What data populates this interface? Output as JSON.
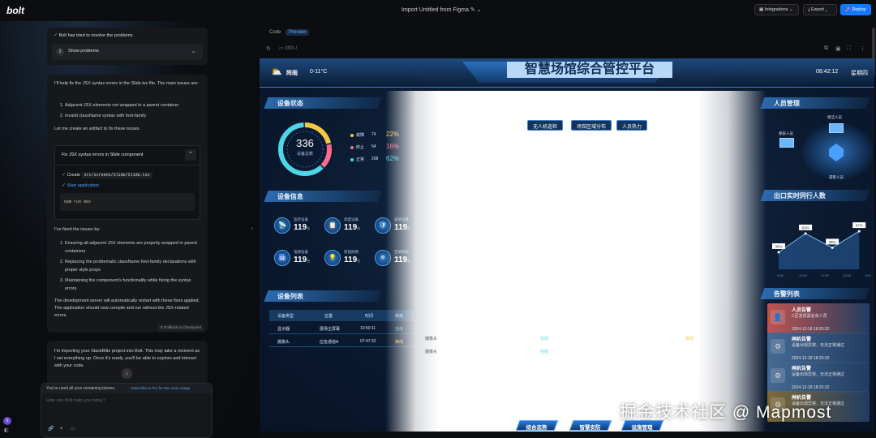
{
  "topbar": {
    "logo": "bolt",
    "project_title": "Import Untitled from Figma",
    "integrations": "Integrations",
    "export": "Export",
    "deploy": "Deploy"
  },
  "chat": {
    "resolved_text": "Bolt has tried to resolve the problems.",
    "show_problems_num": "3",
    "show_problems_label": "Show problems",
    "msg_intro": "I'll help fix the JSX syntax errors in the Slide.tsx file. The main issues are:",
    "issues": [
      "Adjacent JSX elements not wrapped in a parent container",
      "Invalid className syntax with font-family"
    ],
    "msg_artifact": "Let me create an artifact to fix these issues.",
    "artifact_title": "Fix JSX syntax errors in Slide component",
    "artifact_create": "Create",
    "artifact_file": "src/screens/Slide/Slide.tsx",
    "artifact_start": "Start application",
    "artifact_cmd": "npm run dev",
    "fixed_intro": "I've fixed the issues by:",
    "fixes": [
      "Ensuring all adjacent JSX elements are properly wrapped in parent containers",
      "Replacing the problematic className font-family declarations with proper style props",
      "Maintaining the component's functionality while fixing the syntax errors"
    ],
    "fixed_outro": "The development server will automatically restart with these fixes applied. The application should now compile and run without the JSX-related errors.",
    "rollback": "Rollback to Checkpoint",
    "import_msg": "I'm importing your StackBlitz project into Bolt. This may take a moment as I set everything up. Once it's ready, you'll be able to explore and interact with your code.",
    "tokens_msg": "You've used all your remaining tokens.",
    "subscribe_link": "Subscribe to Pro for 66x more usage",
    "input_placeholder": "How can Bolt help you today?",
    "avatar_initial": "b"
  },
  "preview": {
    "tab_code": "Code",
    "tab_preview": "Preview",
    "address": "/",
    "screen": {
      "weather": "阵雨",
      "temp": "0-11°C",
      "title": "智慧场馆综合管控平台",
      "time": "08:42:12",
      "weekday": "星期四",
      "sec_device_status": "设备状态",
      "sec_device_info": "设备信息",
      "sec_device_list": "设备列表",
      "sec_people": "人员管理",
      "sec_traffic": "出口实时同行人数",
      "sec_alarms": "告警列表",
      "pills": [
        "无人机巡检",
        "场馆区域分布",
        "人员热力"
      ],
      "donut": {
        "total": "336",
        "total_label": "设备总数",
        "fault": 0.22,
        "offline": 0.16,
        "normal": 0.62
      },
      "status_rows": [
        {
          "label": "故障",
          "count": "74",
          "pct": "22%",
          "color": "#f5c842"
        },
        {
          "label": "终止",
          "count": "54",
          "pct": "16%",
          "color": "#ff6b8a"
        },
        {
          "label": "正常",
          "count": "208",
          "pct": "62%",
          "color": "#4dd6e8"
        }
      ],
      "devices": [
        {
          "label": "监控设备",
          "value": "119",
          "unit": "台",
          "icon": "📡"
        },
        {
          "label": "调度设备",
          "value": "119",
          "unit": "台",
          "icon": "📋"
        },
        {
          "label": "安防设备",
          "value": "119",
          "unit": "台",
          "icon": "🛡"
        },
        {
          "label": "电梯设备",
          "value": "119",
          "unit": "台",
          "icon": "🛗"
        },
        {
          "label": "智能照明",
          "value": "119",
          "unit": "台",
          "icon": "💡"
        },
        {
          "label": "空调系统",
          "value": "119",
          "unit": "台",
          "icon": "❄"
        }
      ],
      "list_headers": [
        "设备类型",
        "位置",
        "时间",
        "状态"
      ],
      "list_rows": [
        {
          "type": "显示器",
          "loc": "展场主屏幕",
          "time": "10:50:11",
          "status": "在线",
          "status_color": "#4dd6e8"
        },
        {
          "type": "摄像头",
          "loc": "应急通道A",
          "time": "07:47:32",
          "status": "离线",
          "status_color": "#f5c842"
        }
      ],
      "ghost_texts": [
        "在线",
        "离线",
        "在线",
        "摄像头",
        "摄像头"
      ],
      "people_labels": [
        "保洁人员",
        "保安人员",
        "游客人员"
      ],
      "traffic": {
        "points": [
          30,
          63,
          38,
          67
        ],
        "labels": [
          "30%",
          "63%",
          "38%",
          "67%"
        ],
        "axis": [
          "9:00",
          "10:00",
          "11:00",
          "12:00",
          "13:00"
        ]
      },
      "alarms": [
        {
          "title": "人员告警",
          "desc": "C区发现黑名单人员",
          "time": "2024-12-18 18:25:32",
          "color": "#c0544f",
          "icon": "👤"
        },
        {
          "title": "闸机告警",
          "desc": "设备出现异常，无法正常通过",
          "time": "2024-12-18 18:25:32",
          "color": "#466a94",
          "icon": "⚙"
        },
        {
          "title": "闸机告警",
          "desc": "设备出现异常，无法正常通过",
          "time": "2024-12-18 18:25:32",
          "color": "#466a94",
          "icon": "⚙"
        },
        {
          "title": "闸机告警",
          "desc": "设备出现异常，无法正常通过",
          "time": "",
          "color": "#7d6a3a",
          "icon": "⚙"
        }
      ],
      "nav": [
        "综合态势",
        "智慧安防",
        "设施管理"
      ]
    }
  },
  "watermark": "掘金技术社区 @ Mapmost"
}
